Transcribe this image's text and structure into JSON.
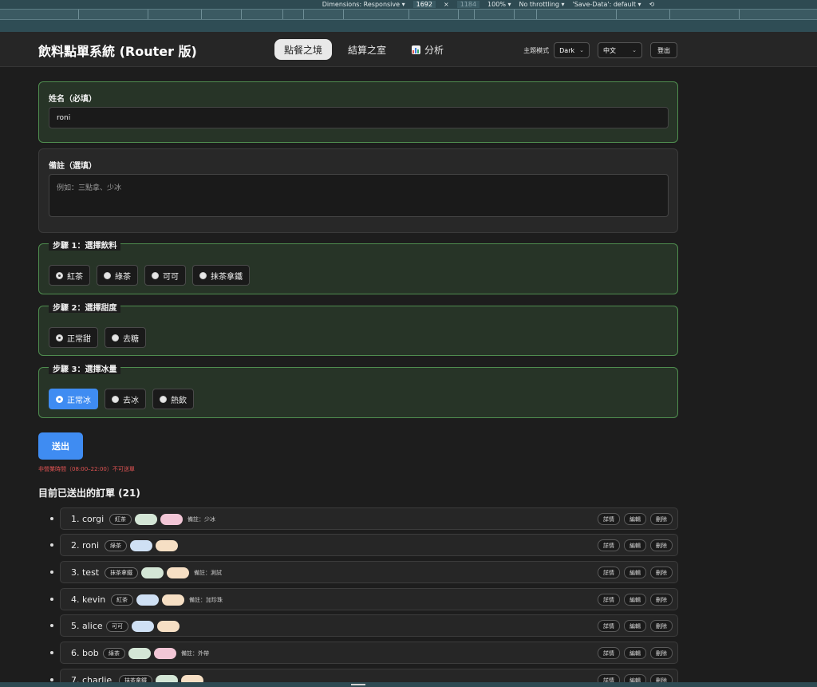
{
  "devtools": {
    "dimensions_label": "Dimensions: Responsive",
    "width": "1692",
    "times": "×",
    "height": "1184",
    "zoom": "100%",
    "throttling": "No throttling",
    "save_data": "'Save-Data': default"
  },
  "header": {
    "title": "飲料點單系統 (Router 版)",
    "nav": [
      {
        "label": "點餐之境",
        "active": true
      },
      {
        "label": "結算之室",
        "active": false
      },
      {
        "label": "分析",
        "active": false,
        "icon": "bar-chart-icon"
      }
    ],
    "theme_label": "主題模式",
    "theme_value": "Dark",
    "lang_value": "中文",
    "logout": "登出"
  },
  "form": {
    "name_label": "姓名（必填）",
    "name_value": "roni",
    "note_label": "備註（選填）",
    "note_placeholder": "例如：三點拿、少冰",
    "step1": {
      "legend": "步驟 1：選擇飲料",
      "options": [
        "紅茶",
        "綠茶",
        "可可",
        "抹茶拿鐵"
      ],
      "selected": 0
    },
    "step2": {
      "legend": "步驟 2：選擇甜度",
      "options": [
        "正常甜",
        "去糖"
      ],
      "selected": 0
    },
    "step3": {
      "legend": "步驟 3：選擇冰量",
      "options": [
        "正常冰",
        "去冰",
        "熱飲"
      ],
      "selected": 0
    },
    "submit": "送出",
    "warning": "非營業時間（08:00–22:00）不可送單"
  },
  "orders": {
    "title": "目前已送出的訂單 (21)",
    "actions": [
      "詳情",
      "編輯",
      "刪除"
    ],
    "items": [
      {
        "label": "1. corgi",
        "drink": "紅茶",
        "pill1": "#d4e6d6",
        "pill2": "#f2c6d6",
        "note": "備註：少冰"
      },
      {
        "label": "2. roni",
        "drink": "綠茶",
        "pill1": "#cfe0f4",
        "pill2": "#f6dfc4",
        "note": ""
      },
      {
        "label": "3. test",
        "drink": "抹茶拿鐵",
        "pill1": "#d4e6d6",
        "pill2": "#f6dfc4",
        "note": "備註：測試"
      },
      {
        "label": "4. kevin",
        "drink": "紅茶",
        "pill1": "#cfe0f4",
        "pill2": "#f6dfc4",
        "note": "備註：加珍珠"
      },
      {
        "label": "5. alice",
        "drink": "可可",
        "pill1": "#cfe0f4",
        "pill2": "#f6dfc4",
        "note": ""
      },
      {
        "label": "6. bob",
        "drink": "綠茶",
        "pill1": "#d4e6d6",
        "pill2": "#f2c6d6",
        "note": "備註：外帶"
      },
      {
        "label": "7. charlie",
        "drink": "抹茶拿鐵",
        "pill1": "#d4e6d6",
        "pill2": "#f6dfc4",
        "note": ""
      }
    ]
  }
}
